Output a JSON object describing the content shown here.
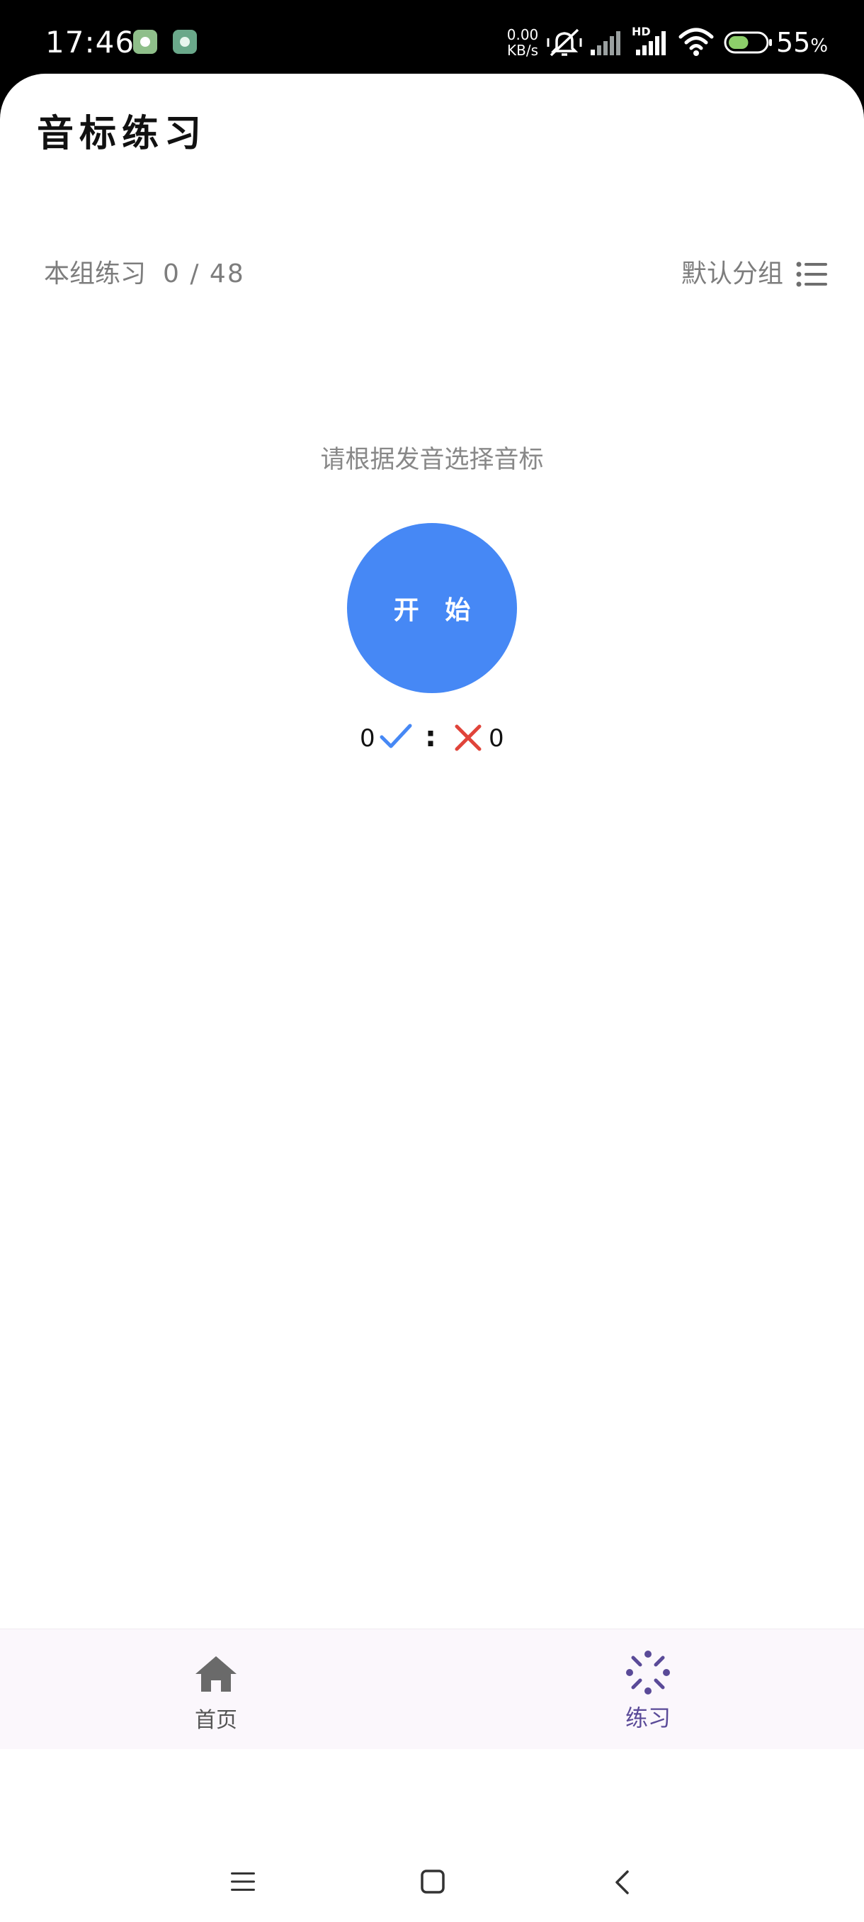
{
  "status_bar": {
    "time": "17:46",
    "net_speed_value": "0.00",
    "net_speed_unit": "KB/s",
    "network_badge": "HD",
    "battery_percent": "55",
    "battery_unit": "%",
    "battery_level": 0.55
  },
  "page": {
    "title": "音标练习"
  },
  "progress": {
    "label": "本组练习",
    "count": "0 / 48"
  },
  "group_selector": {
    "label": "默认分组",
    "icon": "list-icon"
  },
  "practice": {
    "instruction": "请根据发音选择音标",
    "start_label": "开 始"
  },
  "score": {
    "correct": "0",
    "separator": ":",
    "wrong": "0"
  },
  "bottom_nav": {
    "items": [
      {
        "label": "首页",
        "icon": "home-icon",
        "active": false
      },
      {
        "label": "练习",
        "icon": "practice-icon",
        "active": true
      }
    ]
  },
  "colors": {
    "accent": "#4688f5",
    "correct": "#4688f5",
    "wrong": "#e0443a",
    "nav_active": "#5a4a98",
    "nav_inactive": "#555555"
  }
}
